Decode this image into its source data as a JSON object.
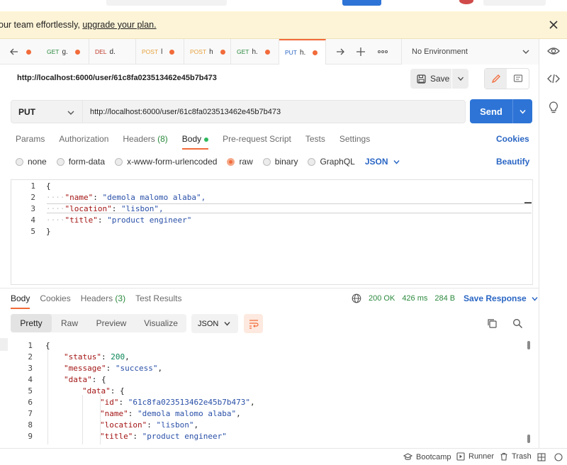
{
  "banner": {
    "text": "our team effortlessly, ",
    "link": "upgrade your plan."
  },
  "tabs": [
    {
      "method": "GET",
      "method_color": "#2b8a3e",
      "name": "g.",
      "dot": true
    },
    {
      "method": "DEL",
      "method_color": "#c0392b",
      "name": "d.",
      "dot": false
    },
    {
      "method": "POST",
      "method_color": "#e6a23c",
      "name": "l",
      "dot": true
    },
    {
      "method": "POST",
      "method_color": "#e6a23c",
      "name": "h",
      "dot": true
    },
    {
      "method": "GET",
      "method_color": "#2b8a3e",
      "name": "h.",
      "dot": true
    },
    {
      "method": "PUT",
      "method_color": "#2a66c4",
      "name": "h.",
      "dot": true,
      "active": true
    }
  ],
  "environment": {
    "label": "No Environment"
  },
  "request": {
    "name": "http://localhost:6000/user/61c8fa023513462e45b7b473",
    "method": "PUT",
    "url": "http://localhost:6000/user/61c8fa023513462e45b7b473",
    "save_label": "Save",
    "send_label": "Send"
  },
  "request_tabs": {
    "params": "Params",
    "authorization": "Authorization",
    "headers": "Headers",
    "headers_count": "(8)",
    "body": "Body",
    "prerequest": "Pre-request Script",
    "tests": "Tests",
    "settings": "Settings",
    "cookies": "Cookies"
  },
  "body_types": {
    "none": "none",
    "form_data": "form-data",
    "urlencoded": "x-www-form-urlencoded",
    "raw": "raw",
    "binary": "binary",
    "graphql": "GraphQL",
    "format": "JSON",
    "beautify": "Beautify"
  },
  "request_body": {
    "line_numbers": [
      "1",
      "2",
      "3",
      "4",
      "5"
    ],
    "brace_open": "{",
    "brace_close": "}",
    "fields": [
      {
        "key": "\"name\"",
        "value": "\"demola malomo alaba\","
      },
      {
        "key": "\"location\"",
        "value": "\"lisbon\","
      },
      {
        "key": "\"title\"",
        "value": "\"product engineer\""
      }
    ]
  },
  "response_tabs": {
    "body": "Body",
    "cookies": "Cookies",
    "headers": "Headers",
    "headers_count": "(3)",
    "test_results": "Test Results"
  },
  "response_meta": {
    "status": "200 OK",
    "time": "426 ms",
    "size": "284 B",
    "save_response": "Save Response"
  },
  "response_view": {
    "pretty": "Pretty",
    "raw": "Raw",
    "preview": "Preview",
    "visualize": "Visualize",
    "format": "JSON"
  },
  "response_body": {
    "line_numbers": [
      "1",
      "2",
      "3",
      "4",
      "5",
      "6",
      "7",
      "8",
      "9"
    ],
    "l1": "{",
    "status_key": "\"status\"",
    "status_val": "200",
    "message_key": "\"message\"",
    "message_val": "\"success\"",
    "data_key": "\"data\"",
    "data_key2": "\"data\"",
    "brace": "{",
    "id_key": "\"id\"",
    "id_val": "\"61c8fa023513462e45b7b473\"",
    "name_key": "\"name\"",
    "name_val": "\"demola malomo alaba\"",
    "location_key": "\"location\"",
    "location_val": "\"lisbon\"",
    "title_key": "\"title\"",
    "title_val": "\"product engineer\""
  },
  "statusbar": {
    "bootcamp": "Bootcamp",
    "runner": "Runner",
    "trash": "Trash"
  },
  "colors": {
    "accent": "#f26b3a",
    "send": "#2e74d6",
    "link": "#2a66c4",
    "ok": "#2b8a3e",
    "banner_bg": "#fdf4d7"
  }
}
